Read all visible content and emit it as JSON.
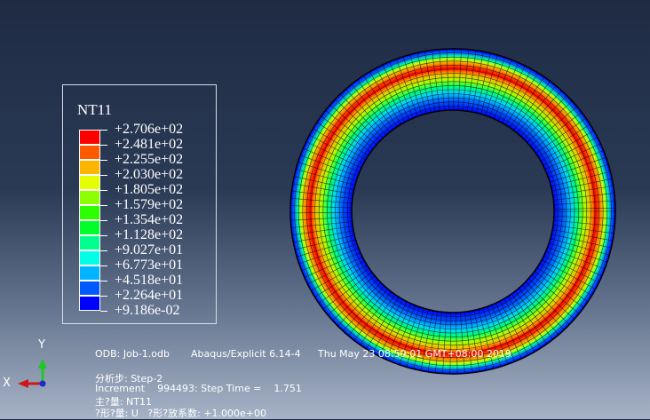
{
  "legend": {
    "title": "NT11",
    "labels": [
      "+2.706e+02",
      "+2.481e+02",
      "+2.255e+02",
      "+2.030e+02",
      "+1.805e+02",
      "+1.579e+02",
      "+1.354e+02",
      "+1.128e+02",
      "+9.027e+01",
      "+6.773e+01",
      "+4.518e+01",
      "+2.264e+01",
      "+9.186e-02"
    ],
    "colors": [
      "#ff0000",
      "#ff5a00",
      "#ffb400",
      "#e6ff00",
      "#8cff00",
      "#2eff00",
      "#00ff28",
      "#00ff8c",
      "#00ffe6",
      "#00b4ff",
      "#005aff",
      "#0000ff"
    ]
  },
  "info": {
    "odb": "ODB: Job-1.odb",
    "version": "Abaqus/Explicit 6.14-4",
    "date": "Thu May 23 08:59:01 GMT+08:00 2019",
    "step": "分析步: Step-2",
    "increment": "Increment    994493: Step Time =    1.751",
    "primary": "主?量: NT11",
    "deformed": "?形?量: U   ?形?放系数: +1.000e+00"
  },
  "triad": {
    "x": "X",
    "y": "Y"
  }
}
